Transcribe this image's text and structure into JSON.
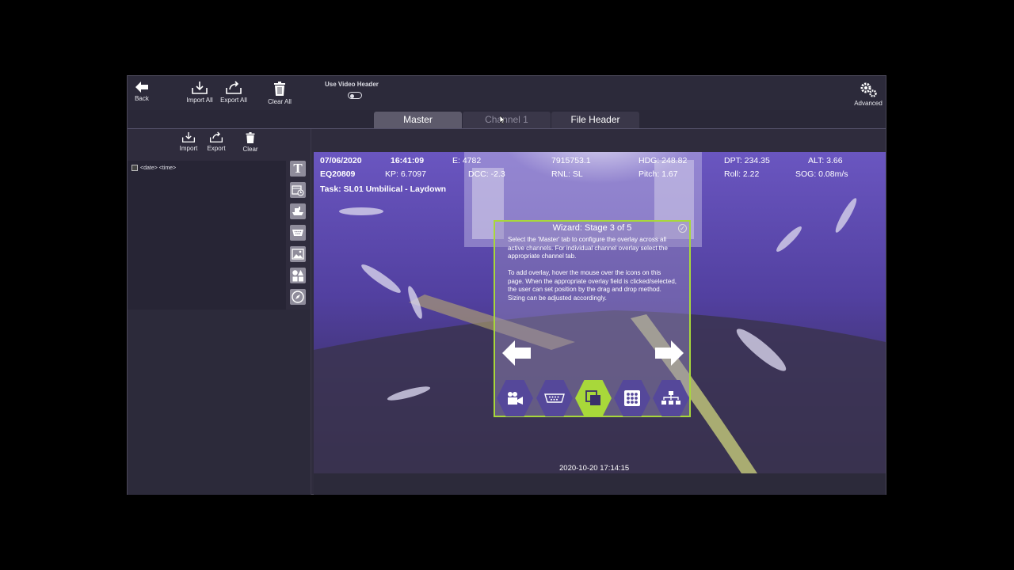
{
  "toolbar": {
    "back_label": "Back",
    "import_all_label": "Import All",
    "export_all_label": "Export All",
    "clear_all_label": "Clear All",
    "use_video_header_label": "Use Video Header",
    "advanced_label": "Advanced"
  },
  "tabs": [
    {
      "label": "Master",
      "active": true
    },
    {
      "label": "Channel 1",
      "active": false
    },
    {
      "label": "File Header",
      "active": false
    }
  ],
  "left_panel": {
    "import_label": "Import",
    "export_label": "Export",
    "clear_label": "Clear",
    "items": [
      {
        "label": "<date> <time>",
        "checked": false
      }
    ],
    "tools": [
      "text-icon",
      "calendar-clock-icon",
      "vessel-icon",
      "serial-port-icon",
      "image-icon",
      "shapes-icon",
      "compass-icon"
    ]
  },
  "overlay": {
    "date": "07/06/2020",
    "time": "16:41:09",
    "easting": "E: 4782",
    "northing": "7915753.1",
    "hdg": "HDG: 248.82",
    "dpt": "DPT: 234.35",
    "alt": "ALT: 3.66",
    "eq": "EQ20809",
    "kp": "KP: 6.7097",
    "dcc": "DCC: -2.3",
    "rnl": "RNL: SL",
    "pitch": "Pitch: 1.67",
    "roll": "Roll: 2.22",
    "sog": "SOG: 0.08m/s",
    "task": "Task: SL01 Umbilical - Laydown",
    "timestamp": "2020-10-20 17:14:15"
  },
  "wizard": {
    "title": "Wizard: Stage 3 of 5",
    "text": "Select the 'Master' tab to configure the overlay across all active channels. For individual channel overlay select the appropriate channel tab.\n\nTo add overlay, hover the mouse over the icons on this page.  When the appropriate overlay field is clicked/selected, the user can set position by the drag and drop method.  Sizing can be adjusted accordingly.",
    "steps": [
      "camera-icon",
      "serial-port-icon",
      "overlay-layers-icon",
      "grid-dots-icon",
      "hierarchy-icon"
    ],
    "selected_step": 3
  },
  "colors": {
    "accent": "#a8d83a",
    "video_tint": "#5a4aa0",
    "panel": "#2f2c3d"
  }
}
